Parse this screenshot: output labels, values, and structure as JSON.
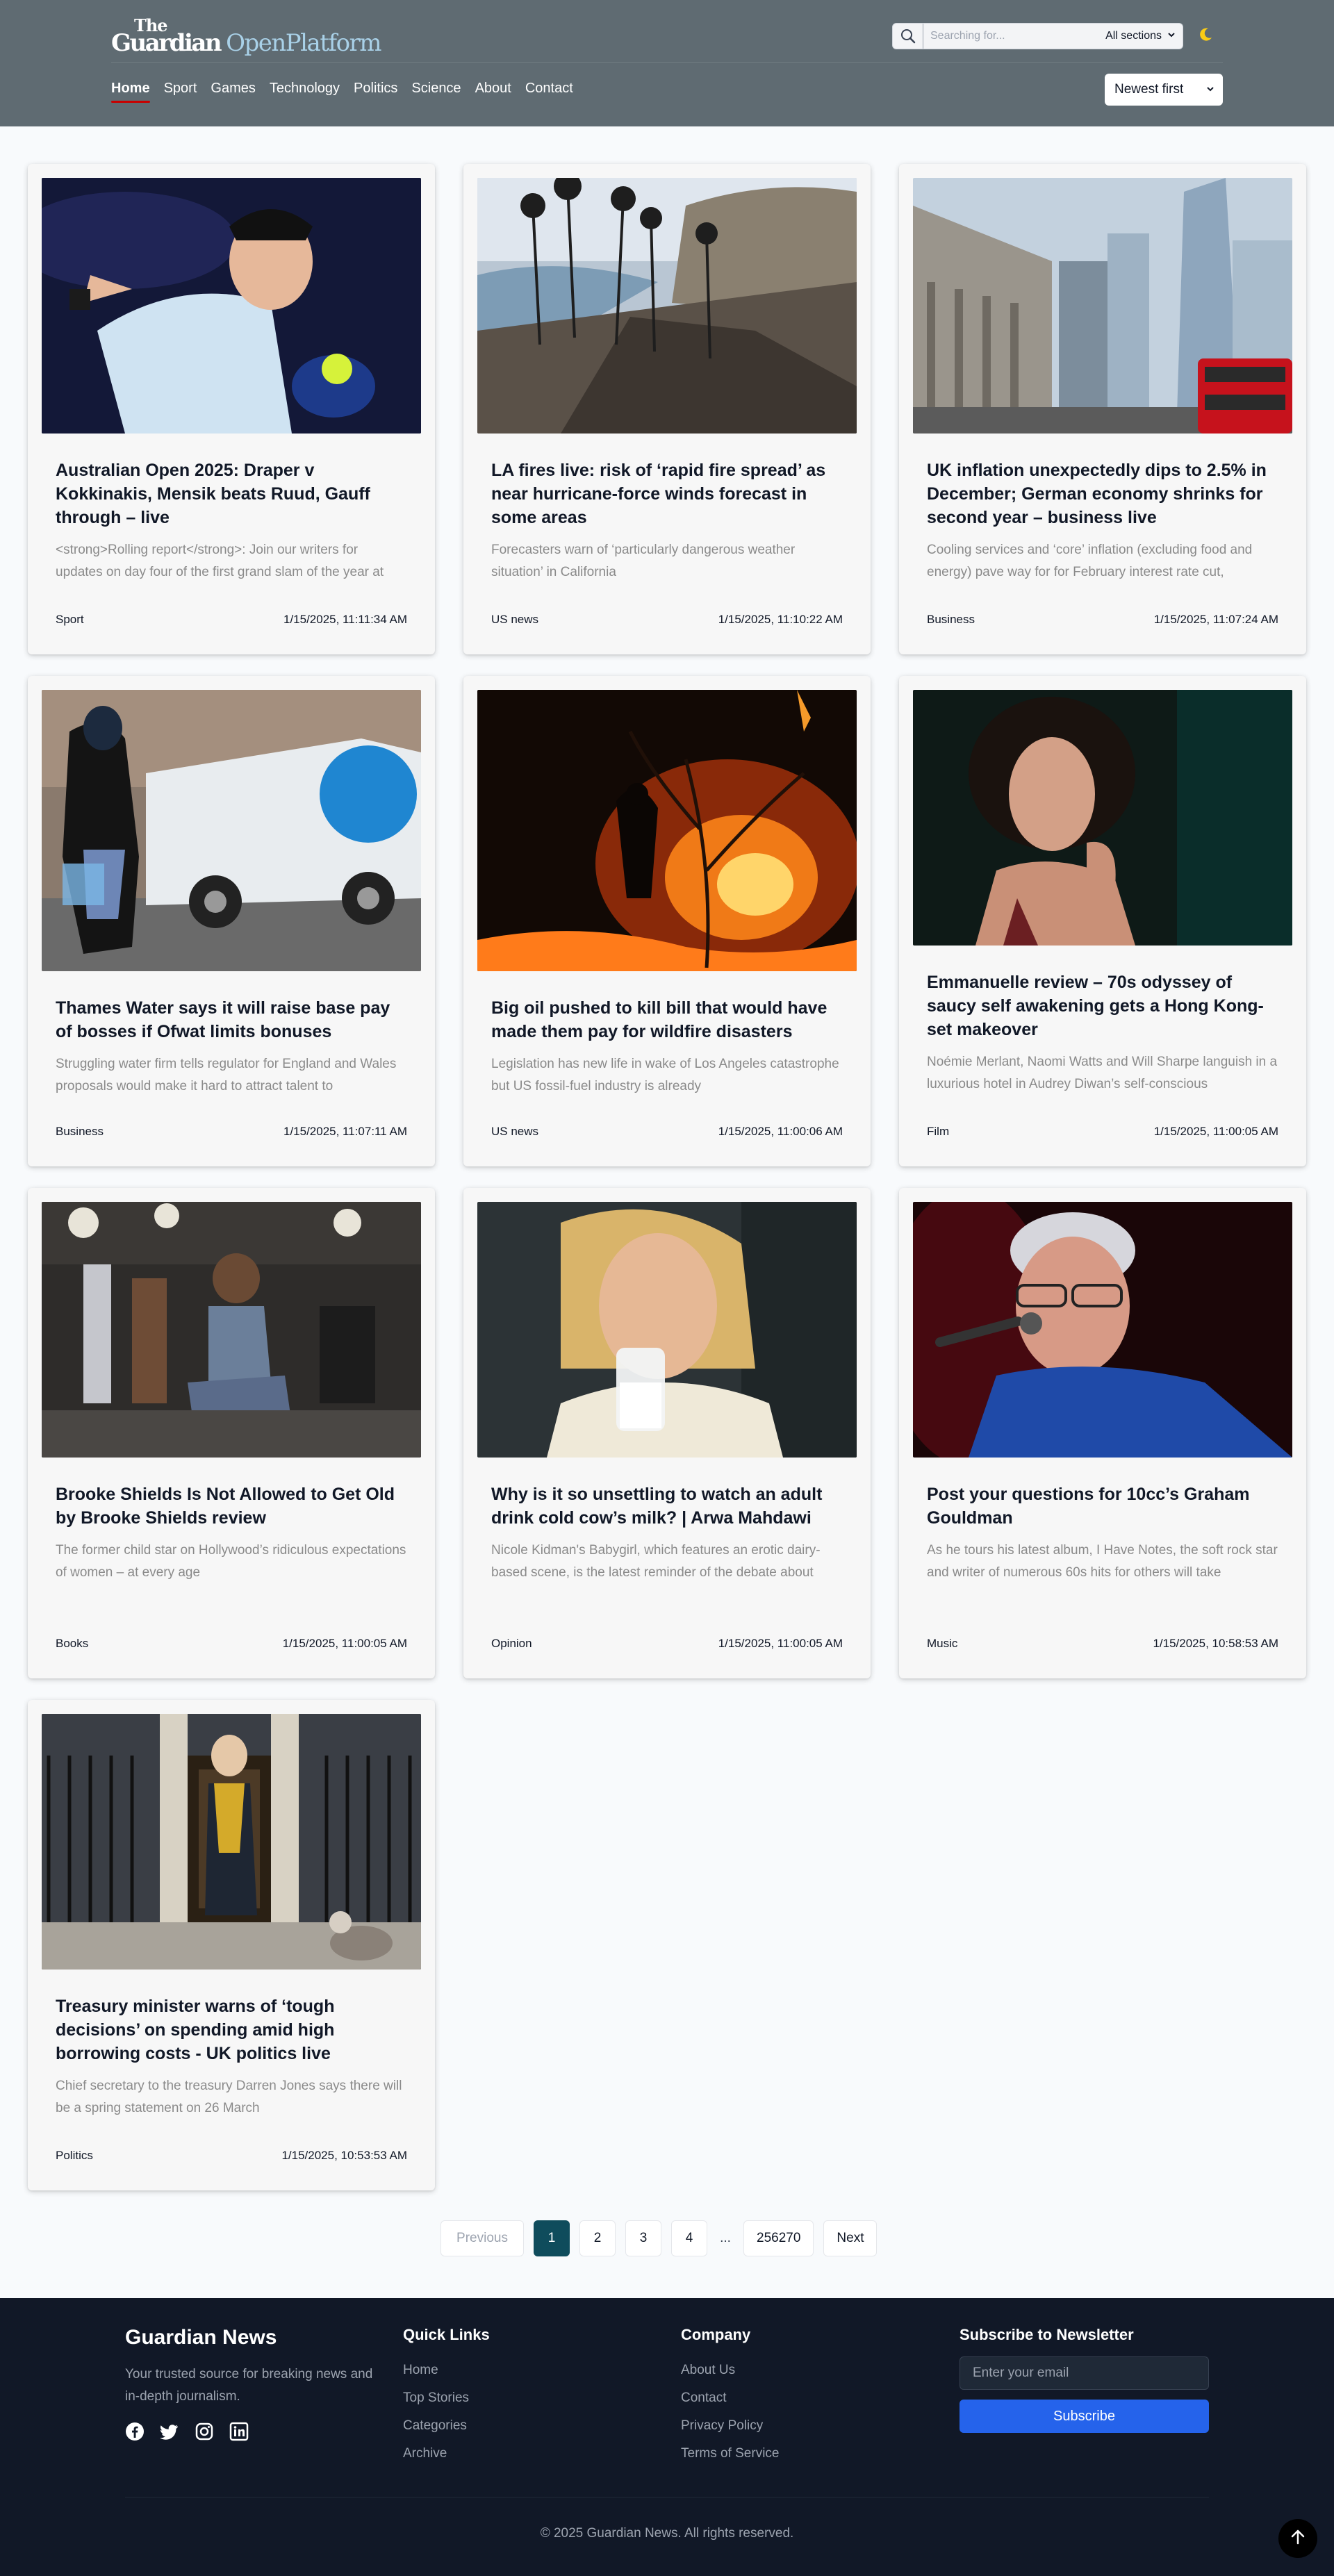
{
  "header": {
    "logo": {
      "the": "The",
      "guardian": "Guardian",
      "platform": "OpenPlatform"
    },
    "search": {
      "placeholder": "Searching for...",
      "section": "All sections"
    },
    "theme_icon": "moon-icon",
    "nav": [
      {
        "label": "Home",
        "active": true
      },
      {
        "label": "Sport"
      },
      {
        "label": "Games"
      },
      {
        "label": "Technology"
      },
      {
        "label": "Politics"
      },
      {
        "label": "Science"
      },
      {
        "label": "About"
      },
      {
        "label": "Contact"
      }
    ],
    "sort": "Newest first"
  },
  "articles": [
    {
      "title": "Australian Open 2025: Draper v Kokkinakis, Mensik beats Ruud, Gauff through – live",
      "description": "<strong>Rolling report</strong>: Join our writers for updates on day four of the first grand slam of the year at",
      "section": "Sport",
      "date": "1/15/2025, 11:11:34 AM",
      "image": "tennis-player"
    },
    {
      "title": "LA fires live: risk of ‘rapid fire spread’ as near hurricane-force winds forecast in some areas",
      "description": "Forecasters warn of ‘particularly dangerous weather situation’ in California",
      "section": "US news",
      "date": "1/15/2025, 11:10:22 AM",
      "image": "burned-coastline"
    },
    {
      "title": "UK inflation unexpectedly dips to 2.5% in December; German economy shrinks for second year – business live",
      "description": "Cooling services and ‘core’ inflation (excluding food and energy) pave way for for February interest rate cut,",
      "section": "Business",
      "date": "1/15/2025, 11:07:24 AM",
      "image": "bank-of-england"
    },
    {
      "title": "Thames Water says it will raise base pay of bosses if Ofwat limits bonuses",
      "description": "Struggling water firm tells regulator for England and Wales proposals would make it hard to attract talent to",
      "section": "Business",
      "date": "1/15/2025, 11:07:11 AM",
      "image": "thames-water-van"
    },
    {
      "title": "Big oil pushed to kill bill that would have made them pay for wildfire disasters",
      "description": "Legislation has new life in wake of Los Angeles catastrophe but US fossil-fuel industry is already",
      "section": "US news",
      "date": "1/15/2025, 11:00:06 AM",
      "image": "wildfire-firefighter"
    },
    {
      "title": "Emmanuelle review – 70s odyssey of saucy self awakening gets a Hong Kong-set makeover",
      "description": "Noémie Merlant, Naomi Watts and Will Sharpe languish in a luxurious hotel in Audrey Diwan’s self-conscious",
      "section": "Film",
      "date": "1/15/2025, 11:00:05 AM",
      "image": "actress-portrait"
    },
    {
      "title": "Brooke Shields Is Not Allowed to Get Old by Brooke Shields review",
      "description": "The former child star on Hollywood’s ridiculous expectations of women – at every age",
      "section": "Books",
      "date": "1/15/2025, 11:00:05 AM",
      "image": "photo-shoot"
    },
    {
      "title": "Why is it so unsettling to watch an adult drink cold cow’s milk? | Arwa Mahdawi",
      "description": "Nicole Kidman's Babygirl, which features an erotic dairy-based scene, is the latest reminder of the debate about",
      "section": "Opinion",
      "date": "1/15/2025, 11:00:05 AM",
      "image": "woman-drinking-milk"
    },
    {
      "title": "Post your questions for 10cc’s Graham Gouldman",
      "description": "As he tours his latest album, I Have Notes, the soft rock star and writer of numerous 60s hits for others will take",
      "section": "Music",
      "date": "1/15/2025, 10:58:53 AM",
      "image": "singer-microphone"
    },
    {
      "title": "Treasury minister warns of ‘tough decisions’ on spending amid high borrowing costs - UK politics live",
      "description": "Chief secretary to the treasury Darren Jones says there will be a spring statement on 26 March",
      "section": "Politics",
      "date": "1/15/2025, 10:53:53 AM",
      "image": "downing-street-door"
    }
  ],
  "pagination": {
    "previous": "Previous",
    "pages": [
      "1",
      "2",
      "3",
      "4"
    ],
    "ellipsis": "...",
    "last": "256270",
    "next": "Next"
  },
  "footer": {
    "brand": "Guardian News",
    "tagline": "Your trusted source for breaking news and in-depth journalism.",
    "socials": [
      "facebook-icon",
      "twitter-icon",
      "instagram-icon",
      "linkedin-icon"
    ],
    "quick_links": {
      "title": "Quick Links",
      "items": [
        "Home",
        "Top Stories",
        "Categories",
        "Archive"
      ]
    },
    "company": {
      "title": "Company",
      "items": [
        "About Us",
        "Contact",
        "Privacy Policy",
        "Terms of Service"
      ]
    },
    "newsletter": {
      "title": "Subscribe to Newsletter",
      "placeholder": "Enter your email",
      "button": "Subscribe"
    },
    "copyright": "© 2025 Guardian News. All rights reserved."
  }
}
